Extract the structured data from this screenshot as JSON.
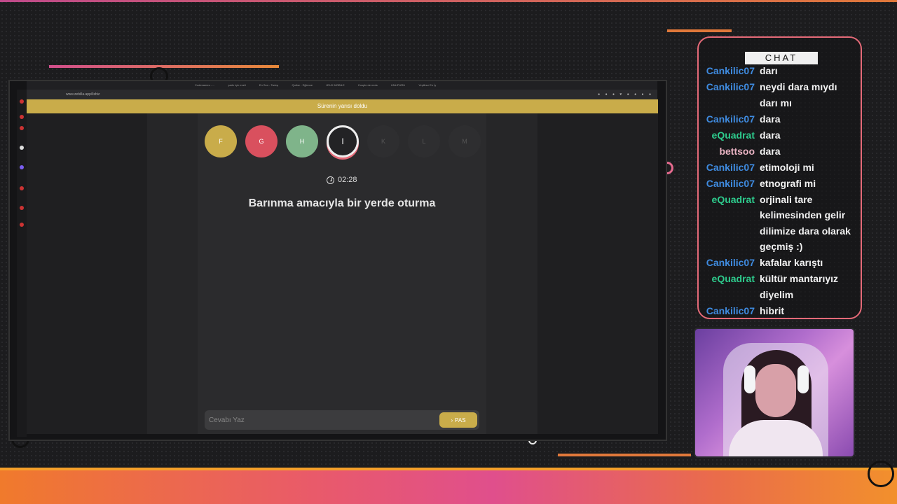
{
  "browser": {
    "tabs": [
      "Codenames - ...",
      "şarkı için ezeli",
      "En Son - Tartışı",
      "Quilne - Eğlence",
      "JEUX MOBILE",
      "Couple de mots",
      "UNLIFURU",
      "Yeşilirez En İy"
    ],
    "url": "www.zebilla.app/lizbiz"
  },
  "game": {
    "banner": "Sürenin yarısı doldu",
    "letters": [
      {
        "label": "F",
        "color": "#c9ac4a",
        "state": "done"
      },
      {
        "label": "G",
        "color": "#d9505e",
        "state": "done"
      },
      {
        "label": "H",
        "color": "#7fb48a",
        "state": "done"
      },
      {
        "label": "I",
        "color": "",
        "state": "active"
      },
      {
        "label": "K",
        "color": "",
        "state": "future"
      },
      {
        "label": "L",
        "color": "",
        "state": "future"
      },
      {
        "label": "M",
        "color": "",
        "state": "future"
      }
    ],
    "timer": "02:28",
    "question": "Barınma amacıyla bir yerde oturma",
    "answer_placeholder": "Cevabı Yaz",
    "pass_label": "PAS"
  },
  "chat": {
    "title": "CHAT",
    "messages": [
      {
        "user": "Cankilic07",
        "color": "blue",
        "text": "darı"
      },
      {
        "user": "Cankilic07",
        "color": "blue",
        "text": "neydi dara mıydı darı mı"
      },
      {
        "user": "Cankilic07",
        "color": "blue",
        "text": "dara"
      },
      {
        "user": "eQuadrat",
        "color": "green",
        "text": "dara"
      },
      {
        "user": "bettsoo",
        "color": "pink",
        "text": "dara"
      },
      {
        "user": "Cankilic07",
        "color": "blue",
        "text": "etimoloji mi"
      },
      {
        "user": "Cankilic07",
        "color": "blue",
        "text": "etnografi mi"
      },
      {
        "user": "eQuadrat",
        "color": "green",
        "text": "orjinali tare kelimesinden gelir dilimize dara olarak geçmiş :)"
      },
      {
        "user": "Cankilic07",
        "color": "blue",
        "text": "kafalar karıştı"
      },
      {
        "user": "eQuadrat",
        "color": "green",
        "text": "kültür mantarıyız diyelim"
      },
      {
        "user": "Cankilic07",
        "color": "blue",
        "text": "hibrit"
      }
    ]
  }
}
